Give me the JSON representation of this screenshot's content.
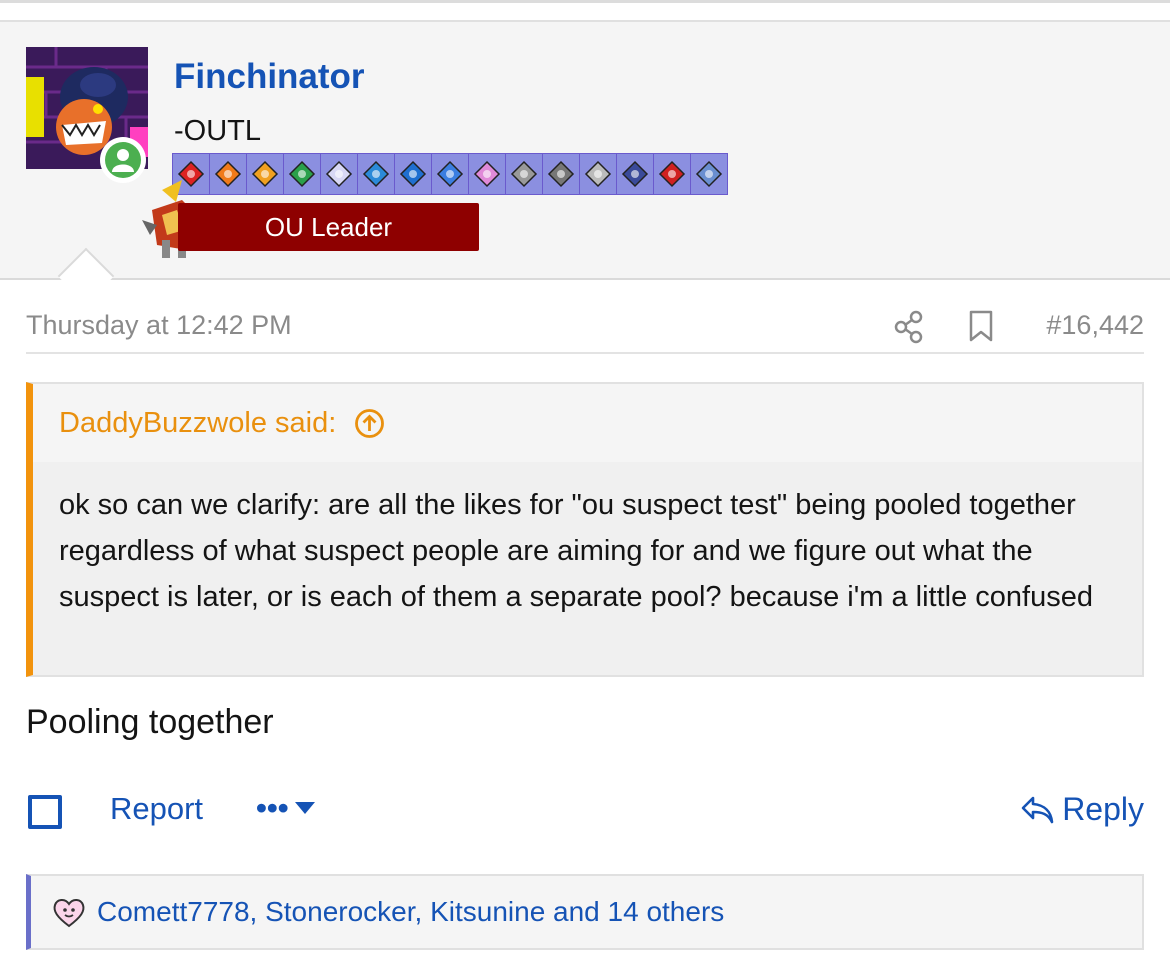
{
  "post": {
    "author": "Finchinator",
    "author_title": "-OUTL",
    "role_banner": "OU Leader",
    "timestamp": "Thursday at 12:42 PM",
    "post_number": "#16,442",
    "message": "Pooling together"
  },
  "quote": {
    "attribution": "DaddyBuzzwole said:",
    "text": "ok so can we clarify: are all the likes for \"ou suspect test\" being pooled together regardless of what suspect people are aiming for and we figure out what the suspect is later, or is each of them a separate pool? because i'm a little confused"
  },
  "actions": {
    "report": "Report",
    "more": "•••",
    "reply": "Reply"
  },
  "reactions": {
    "text": "Comett7778, Stonerocker, Kitsunine and 14 others"
  },
  "badges": [
    {
      "icon": "fire-badge-icon",
      "color": "#d22"
    },
    {
      "icon": "diamond-badge-icon",
      "color": "#f07a1a"
    },
    {
      "icon": "sun-badge-icon",
      "color": "#f0a020"
    },
    {
      "icon": "leaf-badge-icon",
      "color": "#2aa04a"
    },
    {
      "icon": "rock-badge-icon",
      "color": "#d8d8f5"
    },
    {
      "icon": "wave-badge-icon",
      "color": "#2b8ad8"
    },
    {
      "icon": "drop-badge-icon",
      "color": "#1f6fd0"
    },
    {
      "icon": "psychic-badge-icon",
      "color": "#3b7ee0"
    },
    {
      "icon": "fairy-badge-icon",
      "color": "#e08ad8"
    },
    {
      "icon": "steel-badge-icon",
      "color": "#999"
    },
    {
      "icon": "gear-badge-icon",
      "color": "#777"
    },
    {
      "icon": "orb-badge-icon",
      "color": "#bbb"
    },
    {
      "icon": "trophy-badge-icon",
      "color": "#3a4a9a"
    },
    {
      "icon": "medal-badge-icon",
      "color": "#d02020"
    },
    {
      "icon": "star-badge-icon",
      "color": "#6a8fd0"
    }
  ],
  "colors": {
    "link": "#1553b5",
    "quote_accent": "#f2930d",
    "banner": "#8e0000",
    "online": "#4caf50"
  }
}
